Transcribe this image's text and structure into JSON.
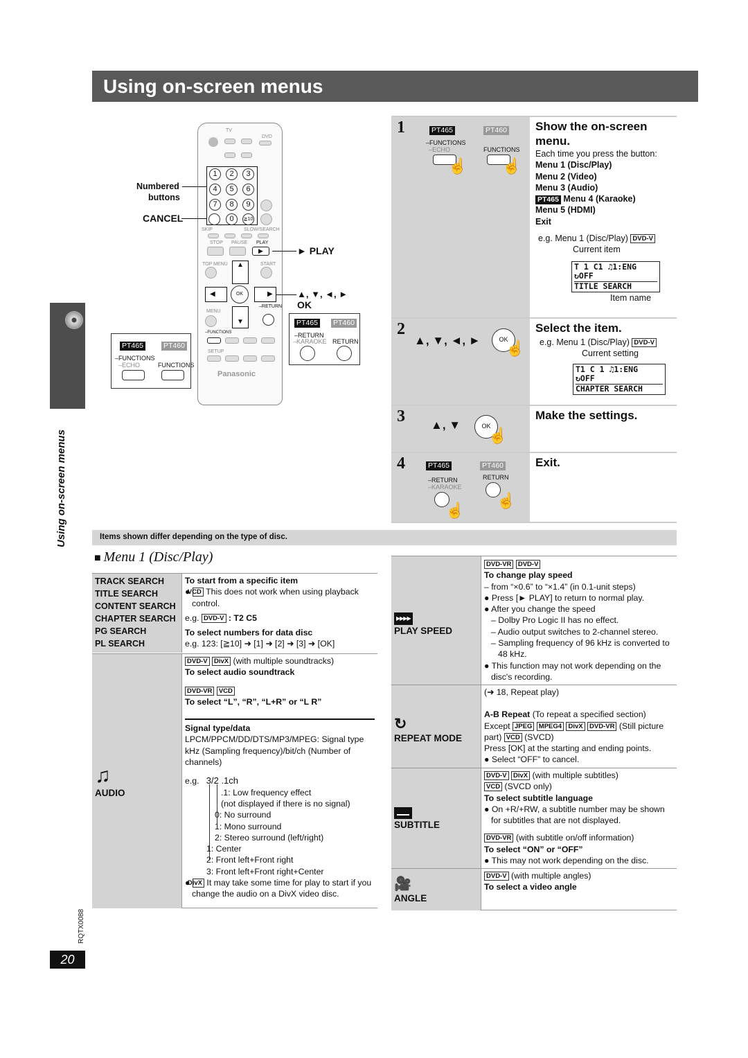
{
  "title": "Using on-screen menus",
  "side_label": "Using on-screen menus",
  "doc_code": "RQTX0088",
  "page_number": "20",
  "remote": {
    "brand": "Panasonic",
    "labels": {
      "numbered": "Numbered",
      "buttons": "buttons",
      "cancel": "CANCEL",
      "play": "► PLAY",
      "arrows": "▲, ▼, ◄, ►",
      "ok": "OK"
    },
    "keys": [
      "1",
      "2",
      "3",
      "4",
      "5",
      "6",
      "7",
      "8",
      "9",
      "0",
      "≧10"
    ],
    "small": {
      "tv": "TV",
      "dvd": "DVD",
      "stop": "STOP",
      "pause": "PAUSE",
      "play": "PLAY",
      "top_menu": "TOP MENU",
      "start": "START",
      "menu": "MENU",
      "ok": "OK",
      "return": "–RETURN",
      "functions": "–FUNCTIONS",
      "setup": "SETUP",
      "skip": "SKIP",
      "slow_search": "SLOW/SEARCH"
    },
    "callout_left": {
      "pt465": "PT465",
      "pt460": "PT460",
      "functions": "–FUNCTIONS",
      "echo": "–ECHO",
      "functions2": "FUNCTIONS"
    },
    "callout_right": {
      "pt465": "PT465",
      "pt460": "PT460",
      "return": "–RETURN",
      "karaoke": "–KARAOKE",
      "return2": "RETURN"
    }
  },
  "steps": [
    {
      "num": "1",
      "pt465": "PT465",
      "pt460": "PT460",
      "btn1": "–FUNCTIONS",
      "btn1b": "–ECHO",
      "btn2": "FUNCTIONS",
      "heading": "Show the on-screen menu.",
      "intro": "Each time you press the button:",
      "menus": [
        "Menu 1 (Disc/Play)",
        "Menu 2 (Video)",
        "Menu 3 (Audio)",
        "Menu 4 (Karaoke)",
        "Menu 5 (HDMI)",
        "Exit"
      ],
      "menu4_badge": "PT465",
      "eg": "e.g. Menu 1 (Disc/Play)",
      "eg_badge": "DVD-V",
      "current_label": "Current item",
      "osd": [
        "T 1 C1   ♫1:ENG",
        "↻OFF",
        "TITLE SEARCH"
      ],
      "item_label": "Item name"
    },
    {
      "num": "2",
      "arrows": "▲, ▼, ◄, ►",
      "ok": "OK",
      "heading": "Select the item.",
      "eg": "e.g. Menu 1 (Disc/Play)",
      "eg_badge": "DVD-V",
      "current_label": "Current setting",
      "osd": [
        "T1  C 1  ♫1:ENG",
        "↻OFF",
        "CHAPTER SEARCH"
      ]
    },
    {
      "num": "3",
      "arrows": "▲, ▼",
      "ok": "OK",
      "heading": "Make the settings."
    },
    {
      "num": "4",
      "pt465": "PT465",
      "pt460": "PT460",
      "btn1": "–RETURN",
      "btn1b": "–KARAOKE",
      "btn2": "RETURN",
      "heading": "Exit."
    }
  ],
  "notes": "Items shown differ depending on the type of disc.",
  "menu_heading": "Menu 1 (Disc/Play)",
  "left_table": {
    "search_items": [
      "TRACK SEARCH",
      "TITLE SEARCH",
      "CONTENT SEARCH",
      "CHAPTER SEARCH",
      "PG SEARCH",
      "PL SEARCH"
    ],
    "search": {
      "h1": "To start from a specific item",
      "vcd": "VCD",
      "vcd_note": "This does not work when using playback control.",
      "eg_pre": "e.g.",
      "eg_badge": "DVD-V",
      "eg_val": ": T2 C5",
      "h2": "To select numbers for data disc",
      "eg2": "e.g. 123: [≧10] ➜ [1] ➜ [2] ➜ [3] ➜ [OK]"
    },
    "audio": {
      "label": "AUDIO",
      "b1": "DVD-V",
      "b2": "DivX",
      "multi": "(with multiple soundtracks)",
      "h1": "To select audio soundtrack",
      "b3": "DVD-VR",
      "b4": "VCD",
      "h2": "To select “L”, “R”, “L+R” or “L R”",
      "h3": "Signal type/data",
      "sig": "LPCM/PPCM/DD/DTS/MP3/MPEG:  Signal type",
      "sig2": "kHz (Sampling frequency)/bit/ch (Number of channels)",
      "eg": "e.g.",
      "eg_val": "3/2 .1ch",
      "lines": [
        ".1:  Low frequency effect",
        "(not displayed if there is no signal)",
        "0:  No surround",
        "1:  Mono surround",
        "2:  Stereo surround (left/right)",
        "1:  Center",
        "2:  Front left+Front right",
        "3:  Front left+Front right+Center"
      ],
      "divx": "DivX",
      "divx_note": "It may take some time for play to start if you change the audio on a DivX video disc."
    }
  },
  "right_table": {
    "play_speed": {
      "label": "PLAY SPEED",
      "b1": "DVD-VR",
      "b2": "DVD-V",
      "h": "To change play speed",
      "lines": [
        "– from “×0.6” to “×1.4” (in 0.1-unit steps)",
        "● Press [► PLAY] to return to normal play.",
        "● After you change the speed"
      ],
      "sub": [
        "– Dolby Pro Logic II has no effect.",
        "– Audio output switches to 2-channel stereo.",
        "– Sampling frequency of 96 kHz is converted to 48 kHz."
      ],
      "last": "● This function may not work depending on the disc's recording."
    },
    "repeat": {
      "label": "REPEAT MODE",
      "ref": "(➜ 18, Repeat play)",
      "ab": "A-B Repeat",
      "ab_note": "(To repeat a specified section)",
      "except": "Except",
      "b": [
        "JPEG",
        "MPEG4",
        "DivX",
        "DVD-VR"
      ],
      "still": "(Still picture part)",
      "vcd": "VCD",
      "svcd": "(SVCD)",
      "press": "Press [OK] at the starting and ending points.",
      "cancel": "● Select “OFF” to cancel."
    },
    "subtitle": {
      "label": "SUBTITLE",
      "b1": "DVD-V",
      "b2": "DivX",
      "multi": "(with multiple subtitles)",
      "vcd": "VCD",
      "svcd": "(SVCD only)",
      "h1": "To select subtitle language",
      "note1": "● On +R/+RW, a subtitle number may be shown for subtitles that are not displayed.",
      "b3": "DVD-VR",
      "onoff": "(with subtitle on/off information)",
      "h2": "To select “ON” or “OFF”",
      "note2": "● This may not work depending on the disc."
    },
    "angle": {
      "label": "ANGLE",
      "b1": "DVD-V",
      "multi": "(with multiple angles)",
      "h": "To select a video angle"
    }
  }
}
